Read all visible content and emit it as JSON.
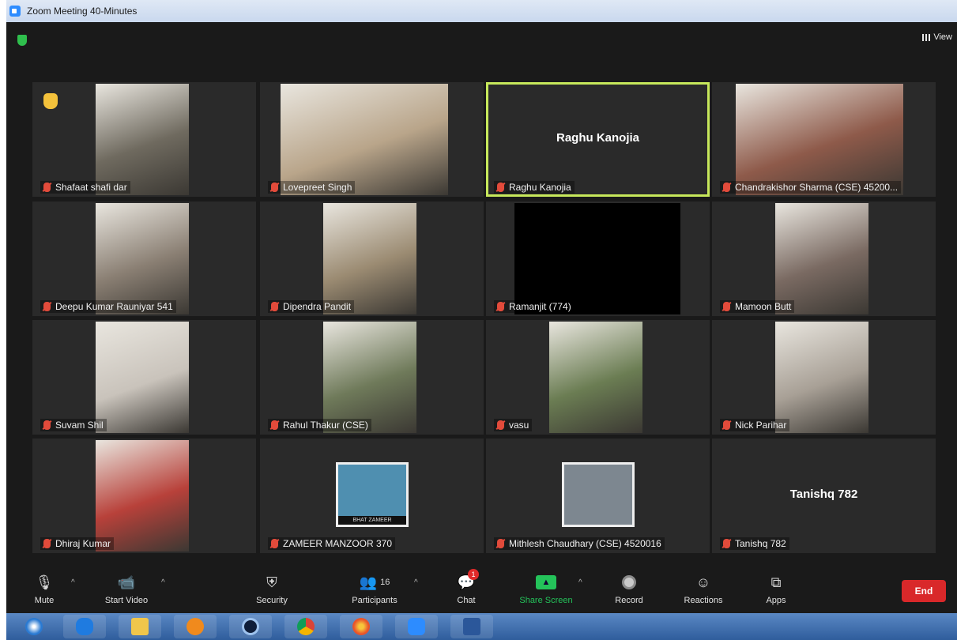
{
  "window": {
    "title": "Zoom Meeting 40-Minutes"
  },
  "view_button": {
    "label": "View"
  },
  "participants": [
    {
      "name": "Shafaat shafi dar",
      "raised_hand": true,
      "video": true,
      "bg": "#6f6a5f"
    },
    {
      "name": "Lovepreet Singh",
      "video": true,
      "bg": "#b9a58a"
    },
    {
      "name": "Raghu Kanojia",
      "video": false,
      "active_speaker": true,
      "display_name": "Raghu Kanojia"
    },
    {
      "name": "Chandrakishor Sharma (CSE) 45200...",
      "video": true,
      "bg": "#8e5a4a"
    },
    {
      "name": "Deepu Kumar Rauniyar 541",
      "video": true,
      "bg": "#8a7f73"
    },
    {
      "name": "Dipendra Pandit",
      "video": true,
      "bg": "#9b8b72"
    },
    {
      "name": "Ramanjit (774)",
      "video": true,
      "black": true,
      "bg": "#000000"
    },
    {
      "name": "Mamoon Butt",
      "video": true,
      "bg": "#7a6a62"
    },
    {
      "name": "Suvam Shil",
      "video": true,
      "bg": "#c9c3bb"
    },
    {
      "name": "Rahul Thakur (CSE)",
      "video": true,
      "bg": "#6f7a5a"
    },
    {
      "name": "vasu",
      "video": true,
      "bg": "#6b7d53"
    },
    {
      "name": "Nick Parihar",
      "video": true,
      "bg": "#a8a096"
    },
    {
      "name": "Dhiraj Kumar",
      "video": true,
      "bg": "#b8413a"
    },
    {
      "name": "ZAMEER MANZOOR 370",
      "video": false,
      "profile_pic": true,
      "pic_caption": "BHAT ZAMEER",
      "bg": "#4f8fb0"
    },
    {
      "name": "Mithlesh Chaudhary (CSE) 4520016",
      "video": false,
      "profile_pic": true,
      "bg": "#7d8790"
    },
    {
      "name": "Tanishq 782",
      "video": false,
      "display_name": "Tanishq 782"
    }
  ],
  "toolbar": {
    "mute": "Mute",
    "start_video": "Start Video",
    "security": "Security",
    "participants": "Participants",
    "participants_count": "16",
    "chat": "Chat",
    "chat_badge": "1",
    "share_screen": "Share Screen",
    "record": "Record",
    "reactions": "Reactions",
    "apps": "Apps",
    "end": "End"
  },
  "colors": {
    "accent_green": "#24c35a",
    "end_red": "#d9282a",
    "speaker_outline": "#c7e85b"
  },
  "taskbar_apps": [
    "windows-start-icon",
    "internet-explorer-icon",
    "file-explorer-icon",
    "media-player-icon",
    "app-c-icon",
    "chrome-icon",
    "firefox-icon",
    "zoom-icon",
    "word-icon"
  ]
}
